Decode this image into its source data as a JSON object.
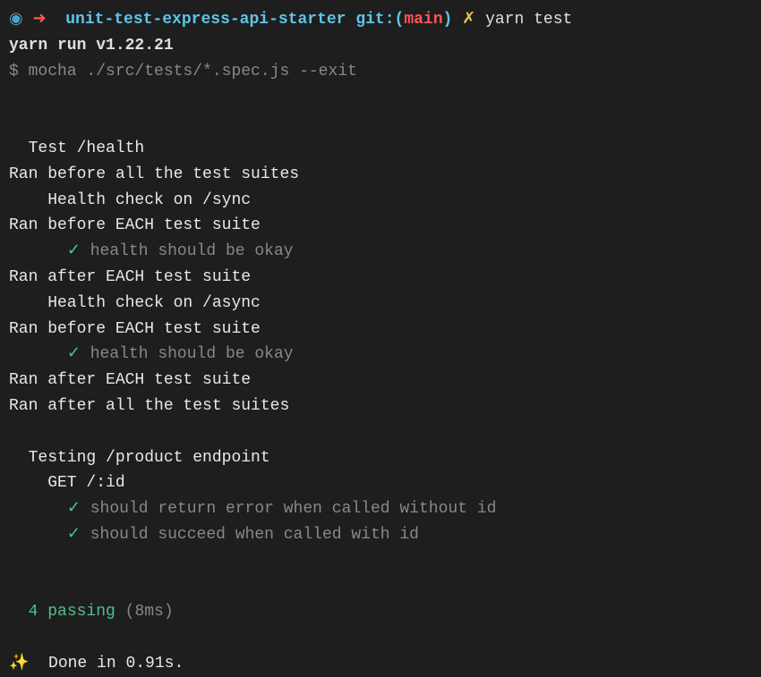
{
  "prompt": {
    "dot": "◉",
    "arrow": "➜",
    "dir": "unit-test-express-api-starter",
    "git_label_open": "git:(",
    "git_branch": "main",
    "git_label_close": ")",
    "dirty": "✗",
    "command": "yarn test"
  },
  "yarn_run": "yarn run v1.22.21",
  "mocha_cmd": "$ mocha ./src/tests/*.spec.js --exit",
  "suite1_title": "  Test /health",
  "hook_before_all": "Ran before all the test suites",
  "sub1_title": "    Health check on /sync",
  "hook_before_each_1": "Ran before EACH test suite",
  "check": "✓",
  "test1": "health should be okay",
  "hook_after_each_1": "Ran after EACH test suite",
  "sub2_title": "    Health check on /async",
  "hook_before_each_2": "Ran before EACH test suite",
  "test2": "health should be okay",
  "hook_after_each_2": "Ran after EACH test suite",
  "hook_after_all": "Ran after all the test suites",
  "suite2_title": "  Testing /product endpoint",
  "sub3_title": "    GET /:id",
  "test3": "should return error when called without id",
  "test4": "should succeed when called with id",
  "pass_count": "4 passing",
  "pass_time": "(8ms)",
  "sparkle": "✨",
  "done": "Done in 0.91s."
}
